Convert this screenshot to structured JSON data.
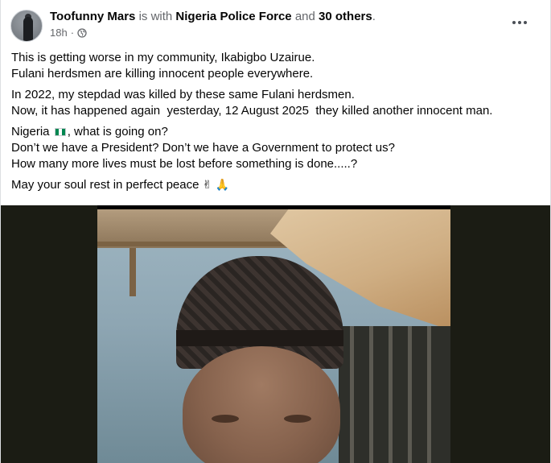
{
  "post": {
    "author": "Toofunny Mars",
    "with_text": "is with",
    "tagged_page": "Nigeria Police Force",
    "and_text": "and",
    "others": "30 others",
    "period": ".",
    "time": "18h",
    "separator": "·",
    "privacy_icon": "globe-icon",
    "more_icon": "more-options-icon",
    "paragraphs": [
      [
        "This is getting worse in my community, Ikabigbo Uzairue.",
        "Fulani herdsmen are killing innocent people everywhere."
      ],
      [
        "In 2022, my stepdad was killed by these same Fulani herdsmen.",
        "Now, it has happened again  yesterday, 12 August 2025  they killed another innocent man."
      ]
    ],
    "para3": {
      "line1_pre": "Nigeria",
      "flag_icon": "nigeria-flag-icon",
      "line1_post": ", what is going on?",
      "line2": "Don’t we have a President? Don’t we have a Government to protect us?",
      "line3": "How many more lives must be lost before something is done.....?"
    },
    "para4": {
      "text": "May your soul rest in perfect peace",
      "emoji1": "✌",
      "emoji2": "🙏"
    }
  },
  "colors": {
    "text": "#050505",
    "muted": "#65676b",
    "nigeria_green": "#008751"
  }
}
